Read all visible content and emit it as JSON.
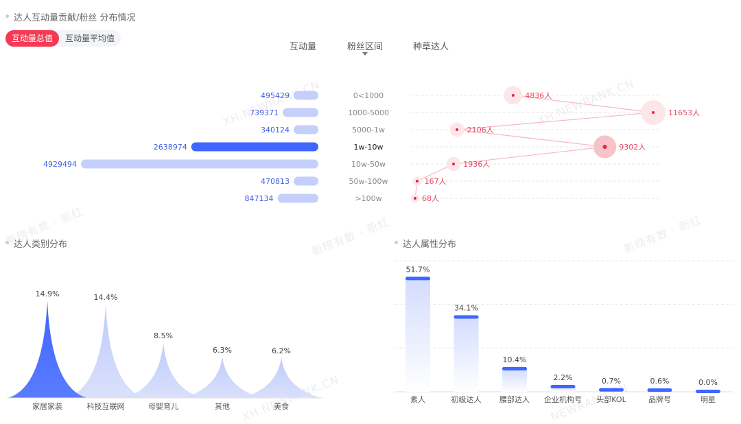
{
  "section_top": {
    "title": "达人互动量贡献/粉丝 分布情况"
  },
  "tabs": [
    {
      "label": "互动量总值",
      "active": true
    },
    {
      "label": "互动量平均值",
      "active": false
    }
  ],
  "columns": {
    "interaction": "互动量",
    "fan_range": "粉丝区间",
    "kol": "种草达人"
  },
  "watermarks": [
    "XH.NEWRANK.CN",
    "XH.NEWRANK.CN",
    "新榜有数 · 新红",
    "新榜有数 · 新红",
    "新榜有数 · 新红",
    "XH.NEWRANK.CN",
    "NEWRANK.CN"
  ],
  "colors": {
    "accent": "#f43a55",
    "bar_blue": "#3f66ff",
    "bar_light": "#c5cffb",
    "pink": "#f0a8b4"
  },
  "chart_data": [
    {
      "type": "bar",
      "orientation": "horizontal",
      "categories": [
        "0<1000",
        "1000-5000",
        "5000-1w",
        "1w-10w",
        "10w-50w",
        "50w-100w",
        ">100w"
      ],
      "values": [
        495429,
        739371,
        340124,
        2638974,
        4929494,
        470813,
        847134
      ],
      "highlight": "1w-10w"
    },
    {
      "type": "scatter",
      "categories": [
        "0<1000",
        "1000-5000",
        "5000-1w",
        "1w-10w",
        "10w-50w",
        "50w-100w",
        ">100w"
      ],
      "values": [
        4836,
        11653,
        2106,
        9302,
        1936,
        167,
        68
      ],
      "labels": [
        "4836人",
        "11653人",
        "2106人",
        "9302人",
        "1936人",
        "167人",
        "68人"
      ],
      "highlight": "1w-10w"
    },
    {
      "type": "area",
      "title": "达人类别分布",
      "categories": [
        "家居家装",
        "科技互联网",
        "母婴育儿",
        "其他",
        "美食"
      ],
      "values": [
        14.9,
        14.4,
        8.5,
        6.3,
        6.2
      ],
      "labels": [
        "14.9%",
        "14.4%",
        "8.5%",
        "6.3%",
        "6.2%"
      ],
      "highlight": "家居家装"
    },
    {
      "type": "bar",
      "title": "达人属性分布",
      "categories": [
        "素人",
        "初级达人",
        "腰部达人",
        "企业机构号",
        "头部KOL",
        "品牌号",
        "明星"
      ],
      "values": [
        51.7,
        34.1,
        10.4,
        2.2,
        0.7,
        0.6,
        0.0
      ],
      "labels": [
        "51.7%",
        "34.1%",
        "10.4%",
        "2.2%",
        "0.7%",
        "0.6%",
        "0.0%"
      ],
      "grid": true
    }
  ],
  "section_cat": {
    "title": "达人类别分布"
  },
  "section_attr": {
    "title": "达人属性分布"
  }
}
